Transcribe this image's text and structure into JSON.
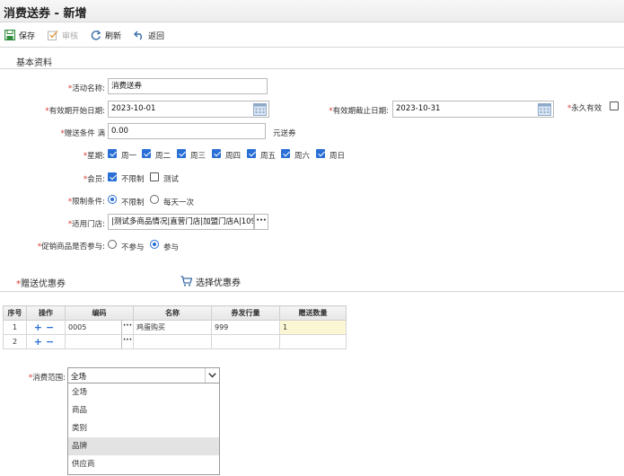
{
  "window": {
    "title": "消费送券 - 新增"
  },
  "toolbar": {
    "save": "保存",
    "audit": "审核",
    "refresh": "刷新",
    "back": "返回"
  },
  "basic_section": {
    "title": "基本资料"
  },
  "form": {
    "activity_name": {
      "label": "活动名称:",
      "value": "消费送券"
    },
    "start_date": {
      "label": "有效期开始日期:",
      "value": "2023-10-01"
    },
    "end_date": {
      "label": "有效期截止日期:",
      "value": "2023-10-31"
    },
    "permanent": {
      "label": "永久有效",
      "checked": false
    },
    "gift_condition": {
      "label": "赠送条件 满",
      "value": "0.00",
      "suffix": "元送券"
    },
    "weekdays": {
      "label": "星期:",
      "items": [
        {
          "label": "周一",
          "checked": true
        },
        {
          "label": "周二",
          "checked": true
        },
        {
          "label": "周三",
          "checked": true
        },
        {
          "label": "周四",
          "checked": true
        },
        {
          "label": "周五",
          "checked": true
        },
        {
          "label": "周六",
          "checked": true
        },
        {
          "label": "周日",
          "checked": true
        }
      ]
    },
    "member": {
      "label": "会员:",
      "unlimited": "不限制",
      "unlimited_checked": true,
      "test": "测试",
      "test_checked": false
    },
    "limit": {
      "label": "限制条件:",
      "unlimited": "不限制",
      "once_a_day": "每天一次",
      "selected": "unlimited"
    },
    "stores": {
      "label": "适用门店:",
      "value": "|测试多商品情况|直营门店|加盟门店A|1090"
    },
    "promo_participate": {
      "label": "促销商品是否参与:",
      "no": "不参与",
      "yes": "参与",
      "selected": "yes"
    }
  },
  "coupon_section": {
    "title": "赠送优惠券",
    "select_label": "选择优惠券"
  },
  "coupon_table": {
    "headers": [
      "序号",
      "操作",
      "编码",
      "名称",
      "券发行量",
      "赠送数量"
    ],
    "rows": [
      {
        "index": "1",
        "code": "0005",
        "name": "鸡蛋购买",
        "issue": "999",
        "quantity": "1"
      },
      {
        "index": "2",
        "code": "",
        "name": "",
        "issue": "",
        "quantity": ""
      }
    ]
  },
  "scope": {
    "label": "消费范围:",
    "selected": "全场",
    "options": [
      "全场",
      "商品",
      "类别",
      "品牌",
      "供应商"
    ],
    "hovered_index": 3
  },
  "colors": {
    "accent": "#2a6fd6",
    "required": "#d9342b",
    "highlight_cell": "#fbf7d5"
  }
}
